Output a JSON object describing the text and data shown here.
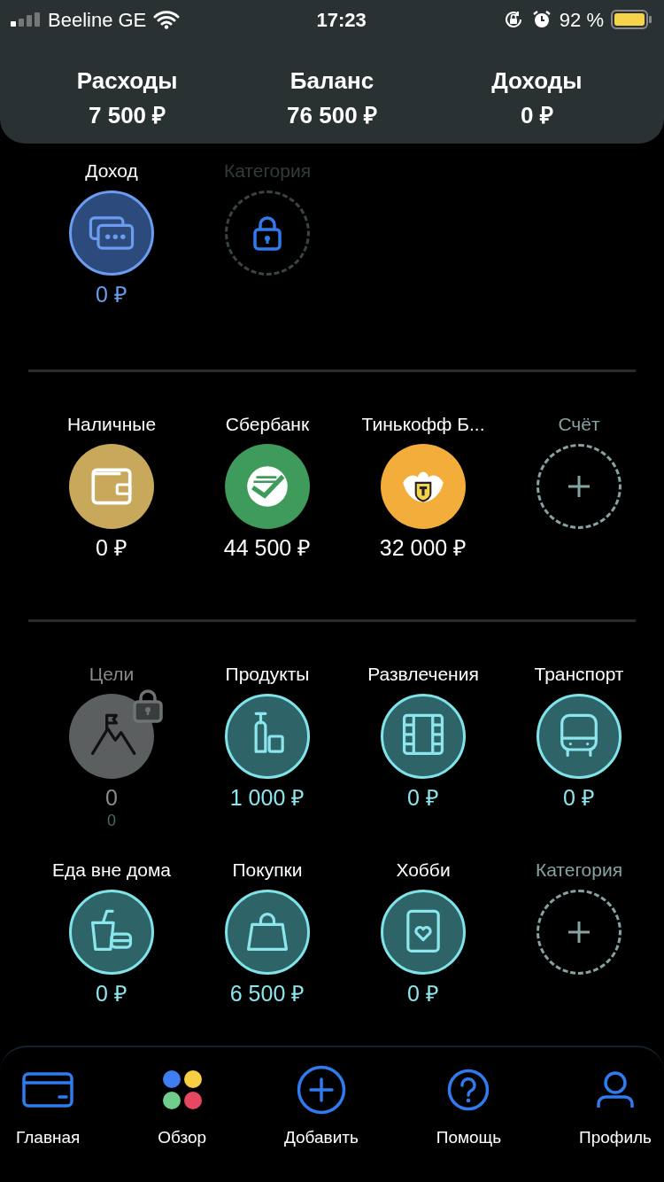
{
  "status_bar": {
    "carrier": "Beeline GE",
    "time": "17:23",
    "battery": "92 %"
  },
  "summary": [
    {
      "label": "Расходы",
      "value": "7 500 ₽"
    },
    {
      "label": "Баланс",
      "value": "76 500 ₽"
    },
    {
      "label": "Доходы",
      "value": "0 ₽"
    }
  ],
  "income": [
    {
      "kind": "income",
      "label": "Доход",
      "amount": "0 ₽"
    },
    {
      "kind": "locked",
      "label": "Категория"
    }
  ],
  "accounts": [
    {
      "kind": "account",
      "label": "Наличные",
      "amount": "0 ₽",
      "color": "#c8a95b"
    },
    {
      "kind": "account",
      "label": "Сбербанк",
      "amount": "44 500 ₽",
      "color": "#3f9b5c"
    },
    {
      "kind": "account",
      "label": "Тинькофф Б...",
      "amount": "32 000 ₽",
      "color": "#f2ad3b"
    },
    {
      "kind": "add",
      "label": "Счёт"
    }
  ],
  "categories": [
    {
      "kind": "category",
      "label": "Цели",
      "amount": "0",
      "sub": "0",
      "locked": true
    },
    {
      "kind": "category",
      "label": "Продукты",
      "amount": "1 000 ₽",
      "locked": false
    },
    {
      "kind": "category",
      "label": "Развлечения",
      "amount": "0 ₽",
      "locked": false
    },
    {
      "kind": "category",
      "label": "Транспорт",
      "amount": "0 ₽",
      "locked": false
    },
    {
      "kind": "category",
      "label": "Еда вне дома",
      "amount": "0 ₽",
      "locked": false
    },
    {
      "kind": "category",
      "label": "Покупки",
      "amount": "6 500 ₽",
      "locked": false
    },
    {
      "kind": "category",
      "label": "Хобби",
      "amount": "0 ₽",
      "locked": false
    },
    {
      "kind": "add",
      "label": "Категория"
    }
  ],
  "nav": [
    {
      "label": "Главная"
    },
    {
      "label": "Обзор"
    },
    {
      "label": "Добавить"
    },
    {
      "label": "Помощь"
    },
    {
      "label": "Профиль"
    }
  ]
}
